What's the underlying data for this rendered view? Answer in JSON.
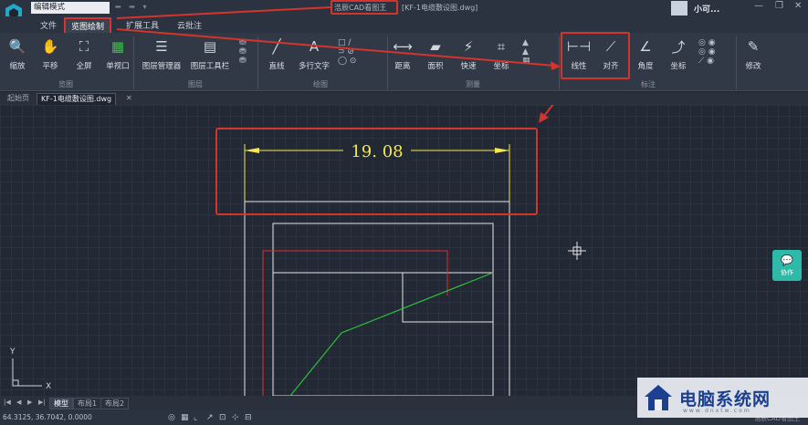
{
  "titlebar": {
    "mode_select": "编辑模式",
    "app_name": "浩辰CAD看图王",
    "file_title": "[KF-1电缆敷设图.dwg]",
    "user_name": "小可..."
  },
  "menu": {
    "file": "文件",
    "view_draw": "览图绘制",
    "ext_tools": "扩展工具",
    "cloud_note": "云批注"
  },
  "ribbon": {
    "buttons": {
      "zoom": "缩放",
      "pan": "平移",
      "fullscreen": "全屏",
      "single_view": "单视口",
      "layer_manager": "图层管理器",
      "layer_toolbar": "图层工具栏",
      "line": "直线",
      "mtext": "多行文字",
      "distance": "距离",
      "area": "面积",
      "quick": "快速",
      "coord_measure": "坐标",
      "linear": "线性",
      "aligned": "对齐",
      "angle": "角度",
      "coord_dim": "坐标",
      "modify": "修改"
    },
    "groups": {
      "view": "览图",
      "layers": "图层",
      "draw": "绘图",
      "measure": "测量",
      "annotate": "标注"
    }
  },
  "doc_tabs": [
    "起始页",
    "KF-1电缆敷设图.dwg"
  ],
  "drawing": {
    "dimension_value": "19. 08",
    "ucs_x": "X",
    "ucs_y": "Y"
  },
  "assist": {
    "label": "协作"
  },
  "layout_tabs": [
    "模型",
    "布局1",
    "布局2"
  ],
  "status": {
    "coordinates": "64.3125, 36.7042, 0.0000",
    "brand": "浩辰CAD看图王"
  },
  "watermark": {
    "title": "电脑系统网",
    "url": "www.dnxtw.com"
  },
  "colors": {
    "highlight_red": "#d3342c",
    "dimension_yellow": "#f2e94e",
    "geometry_white": "#e6e6e6",
    "red_layer": "#d9302b",
    "green_layer": "#2fbf3a",
    "assist_teal": "#2fb9a9"
  }
}
